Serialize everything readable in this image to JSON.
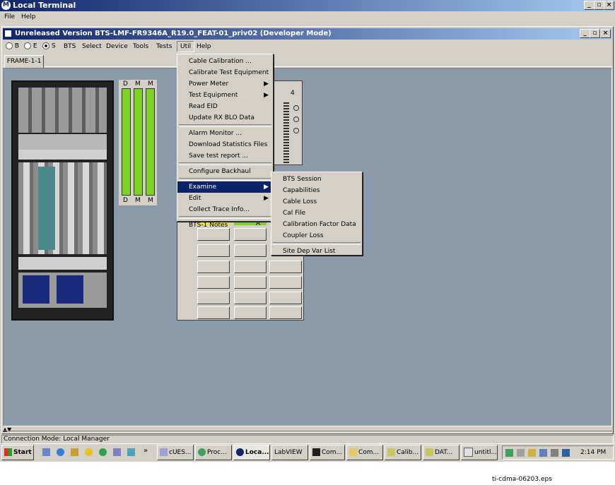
{
  "outer_window": {
    "title": "Local Terminal",
    "menu": [
      "File",
      "Help"
    ]
  },
  "inner_window": {
    "title": "Unreleased Version BTS-LMF-FR9346A_R19.0_FEAT-01_priv02 (Developer Mode)",
    "radios": [
      "B",
      "E",
      "S"
    ],
    "menu": [
      "BTS",
      "Select",
      "Device",
      "Tools",
      "Tests",
      "Util",
      "Help"
    ],
    "active_menu": "Util",
    "tab": "FRAME-1-1"
  },
  "frame": {
    "top_labels": [
      "D",
      "M",
      "M"
    ],
    "bottom_labels": [
      "D",
      "M",
      "M"
    ],
    "right_panel_label": "4",
    "channel_marker": "A"
  },
  "util_menu": {
    "items": [
      {
        "label": "Cable Calibration ...",
        "submenu": false
      },
      {
        "label": "Calibrate Test Equipment",
        "submenu": false
      },
      {
        "label": "Power Meter",
        "submenu": true
      },
      {
        "label": "Test Equipment",
        "submenu": true
      },
      {
        "label": "Read EID",
        "submenu": false
      },
      {
        "label": "Update RX BLO Data",
        "submenu": false
      },
      {
        "label": "Alarm Monitor ...",
        "submenu": false
      },
      {
        "label": "Download Statistics Files",
        "submenu": false
      },
      {
        "label": "Save test report ...",
        "submenu": false
      },
      {
        "label": "Configure Backhaul",
        "submenu": false
      },
      {
        "label": "Examine",
        "submenu": true,
        "selected": true
      },
      {
        "label": "Edit",
        "submenu": true
      },
      {
        "label": "Collect Trace Info...",
        "submenu": false
      },
      {
        "label": "BTS-1 Notes",
        "submenu": false
      }
    ]
  },
  "examine_menu": {
    "items": [
      "BTS Session",
      "Capabilities",
      "Cable Loss",
      "Cal File",
      "Calibration Factor Data",
      "Coupler Loss",
      "Site Dep Var List"
    ]
  },
  "status": {
    "connection": "Connection Mode: Local Manager"
  },
  "taskbar": {
    "start": "Start",
    "overflow": "»",
    "tasks": [
      "cUES...",
      "Proc...",
      "Loca...",
      "LabVIEW",
      "Com...",
      "Com...",
      "Calib...",
      "DAT...",
      "untitl..."
    ],
    "clock": "2:14 PM"
  },
  "caption": "ti-cdma-06203.eps",
  "colors": {
    "title_start": "#10246a",
    "title_end": "#a6caf0",
    "workspace": "#8a9aa8",
    "card_green": "#7ed321",
    "menu_highlight": "#0a246a",
    "face": "#d4d0c8"
  }
}
